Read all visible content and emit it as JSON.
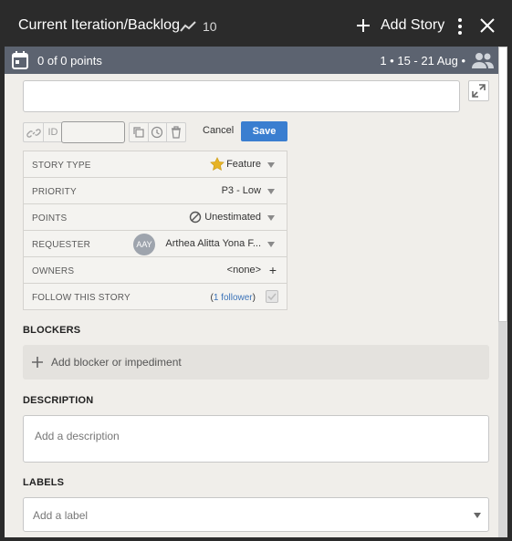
{
  "header": {
    "title": "Current Iteration/Backlog",
    "velocity": "10",
    "add_story_label": "Add Story"
  },
  "subbar": {
    "points": "0 of 0 points",
    "iteration": "1 • 15 - 21 Aug •"
  },
  "form": {
    "story_name_value": "",
    "id_label": "ID",
    "id_value": "",
    "cancel_label": "Cancel",
    "save_label": "Save"
  },
  "details": [
    {
      "label": "STORY TYPE",
      "value": "Feature"
    },
    {
      "label": "PRIORITY",
      "value": "P3 - Low"
    },
    {
      "label": "POINTS",
      "value": "Unestimated"
    },
    {
      "label": "REQUESTER",
      "value": "Arthea Alitta Yona F...",
      "avatar": "AAY"
    },
    {
      "label": "OWNERS",
      "value": "<none>"
    },
    {
      "label": "FOLLOW THIS STORY",
      "value_prefix": "(",
      "value_link": "1 follower",
      "value_suffix": ")"
    }
  ],
  "blockers": {
    "title": "BLOCKERS",
    "add_label": "Add blocker or impediment"
  },
  "description": {
    "title": "DESCRIPTION",
    "placeholder": "Add a description"
  },
  "labels": {
    "title": "LABELS",
    "placeholder": "Add a label"
  },
  "colors": {
    "accent": "#3a7ed0",
    "header_bg": "#2b2b2b",
    "subbar_bg": "#5c6370",
    "panel_bg": "#f0eeea",
    "star": "#e6b325"
  }
}
